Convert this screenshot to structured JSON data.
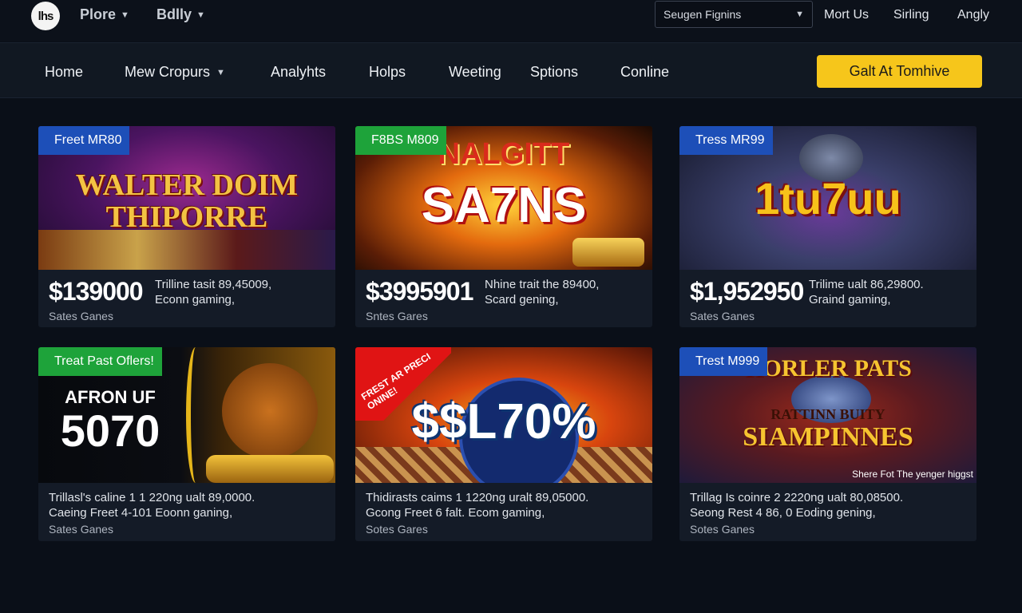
{
  "topbar": {
    "logo_text": "lhs",
    "menu": [
      {
        "label": "Plore"
      },
      {
        "label": "Bdlly"
      }
    ],
    "search_select": {
      "value": "Seugen Fignins"
    },
    "links": [
      "Mort Us",
      "Sirling",
      "Angly"
    ]
  },
  "nav": {
    "items": [
      "Home",
      "Mew Cropurs",
      "Analyhts",
      "Holps",
      "Weeting",
      "Sptions",
      "Conline"
    ],
    "cta_label": "Galt At Tomhive"
  },
  "cards": [
    {
      "badge": "Freet MR80",
      "art_title_line1": "WALTER DOIM",
      "art_title_line2": "THIPORRE",
      "price": "$139000",
      "desc_line1": "Trilline tasit 89,45009,",
      "desc_line2": "Econn gaming,",
      "category": "Sates Ganes"
    },
    {
      "badge": "F8BS M809",
      "art_title_line1": "NALGITT",
      "art_title_line2": "SA7NS",
      "price": "$3995901",
      "desc_line1": "Nhine trait the 89400,",
      "desc_line2": "Scard gening,",
      "category": "Sntes Gares"
    },
    {
      "badge": "Tress MR99",
      "art_title_line1": "1tu7uu",
      "price": "$1,952950",
      "desc_line1": "Trilime ualt 86,29800.",
      "desc_line2": "Graind gaming,",
      "category": "Sates Ganes"
    },
    {
      "badge": "Treat Past Oflers!",
      "art_title_line1": "AFRON UF",
      "art_title_line2": "5070",
      "desc_line1": "Trillasl's caline 1 1 220ng ualt 89,0000.",
      "desc_line2": "Caeing Freet 4-101 Eoonn ganing,",
      "category": "Sates Ganes"
    },
    {
      "badge": "FREST AR PRECI ONINE!",
      "art_title_line1": "$$L70%",
      "desc_line1": "Thidirasts caims 1 1220ng uralt 89,05000.",
      "desc_line2": "Gcong Freet 6 falt. Ecom gaming,",
      "category": "Sotes Gares"
    },
    {
      "badge": "Trest M999",
      "art_title_line1": "HORLER PATS",
      "art_title_line2": "RATTINN BUITY",
      "art_title_line3": "SIAMPINNES",
      "art_caption": "Shere Fot The yenger higgst",
      "desc_line1": "Trillag Is coinre 2 2220ng ualt 80,08500.",
      "desc_line2": "Seong Rest 4 86, 0 Eoding gening,",
      "category": "Sotes Ganes"
    }
  ],
  "colors": {
    "background": "#0a0f18",
    "cta": "#f6c61b",
    "badge_blue": "#1d4fb8",
    "badge_green": "#1ea33a"
  }
}
